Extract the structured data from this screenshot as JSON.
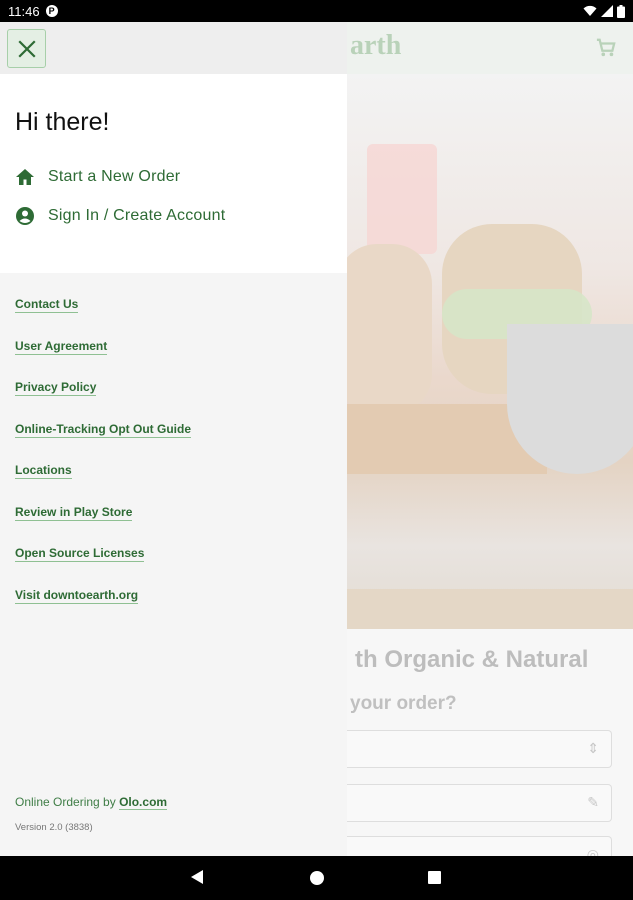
{
  "status_bar": {
    "time": "11:46",
    "badge": "P"
  },
  "app": {
    "logo_text": "arth",
    "heading": "th Organic & Natural",
    "subheading": "your order?",
    "field_glyphs": [
      "⇕",
      "✎",
      "◎"
    ]
  },
  "drawer": {
    "greeting": "Hi there!",
    "nav_items": [
      {
        "label": "Start a New Order",
        "icon": "home-icon"
      },
      {
        "label": "Sign In / Create Account",
        "icon": "account-circle-icon"
      }
    ],
    "links": [
      "Contact Us",
      "User Agreement",
      "Privacy Policy",
      "Online-Tracking Opt Out Guide",
      "Locations",
      "Review in Play Store",
      "Open Source Licenses",
      "Visit downtoearth.org"
    ],
    "footer_prefix": "Online Ordering by",
    "footer_link": "Olo.com",
    "version": "Version 2.0 (3838)"
  },
  "colors": {
    "accent": "#2e6b35",
    "underline": "#8fc093"
  }
}
